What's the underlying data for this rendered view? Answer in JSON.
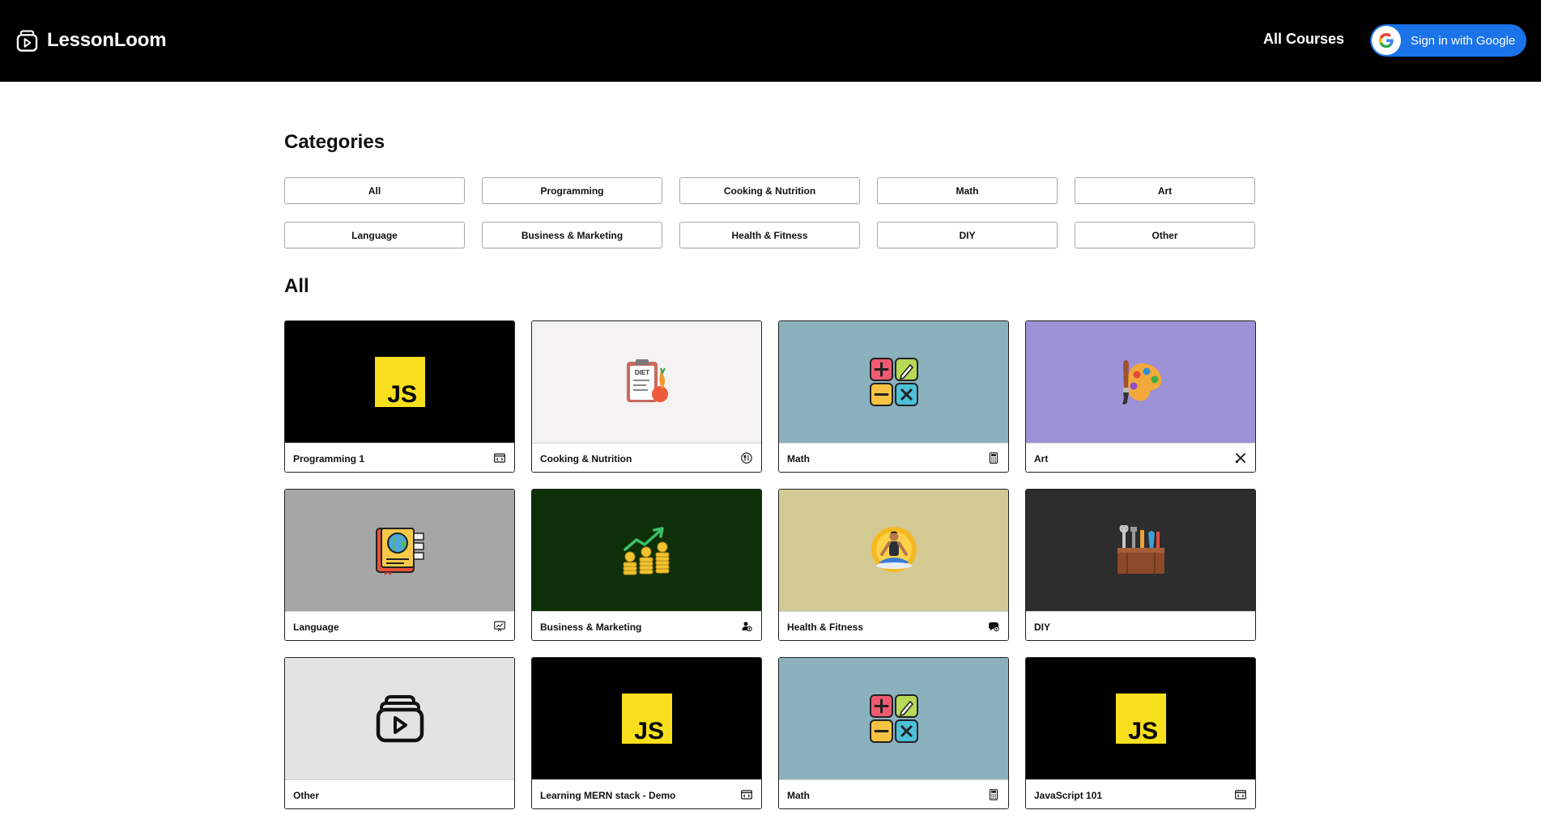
{
  "app": {
    "name": "LessonLoom"
  },
  "nav": {
    "all_courses": "All Courses",
    "sign_in": "Sign in with Google"
  },
  "categories": {
    "heading": "Categories",
    "items": [
      "All",
      "Programming",
      "Cooking & Nutrition",
      "Math",
      "Art",
      "Language",
      "Business & Marketing",
      "Health & Fitness",
      "DIY",
      "Other"
    ]
  },
  "section": {
    "heading": "All"
  },
  "courses": [
    {
      "title": "Programming 1",
      "thumb": "js-logo",
      "bg": "#000000",
      "icon": "code-window-icon"
    },
    {
      "title": "Cooking & Nutrition",
      "thumb": "diet-clipboard",
      "bg": "#f4f2f2",
      "icon": "utensils-icon"
    },
    {
      "title": "Math",
      "thumb": "math-operators",
      "bg": "#8bb1bf",
      "icon": "calculator-icon"
    },
    {
      "title": "Art",
      "thumb": "paint-palette",
      "bg": "#9b92d8",
      "icon": "brush-icon"
    },
    {
      "title": "Language",
      "thumb": "language-book",
      "bg": "#a6a6a6",
      "icon": "presentation-icon"
    },
    {
      "title": "Business & Marketing",
      "thumb": "growth-coins",
      "bg": "#0e3008",
      "icon": "business-icon"
    },
    {
      "title": "Health & Fitness",
      "thumb": "meditation-person",
      "bg": "#d3c993",
      "icon": "fitness-icon"
    },
    {
      "title": "DIY",
      "thumb": "toolbox",
      "bg": "#2d2d2d",
      "icon": ""
    },
    {
      "title": "Other",
      "thumb": "course-stack",
      "bg": "#e3e3e3",
      "icon": ""
    },
    {
      "title": "Learning MERN stack - Demo",
      "thumb": "js-logo",
      "bg": "#000000",
      "icon": "code-window-icon"
    },
    {
      "title": "Math",
      "thumb": "math-operators",
      "bg": "#8bb1bf",
      "icon": "calculator-icon"
    },
    {
      "title": "JavaScript 101",
      "thumb": "js-logo",
      "bg": "#000000",
      "icon": "code-window-icon"
    }
  ]
}
